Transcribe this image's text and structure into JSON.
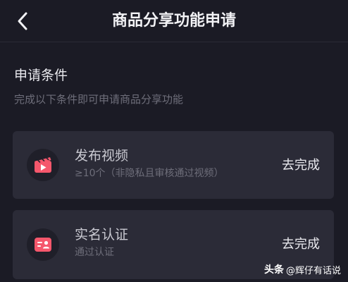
{
  "header": {
    "back_icon": "chevron-left-icon",
    "title": "商品分享功能申请"
  },
  "section": {
    "title": "申请条件",
    "subtitle": "完成以下条件即可申请商品分享功能"
  },
  "conditions": [
    {
      "icon": "video-clapper-icon",
      "title": "发布视频",
      "description": "≥10个（非隐私且审核通过视频）",
      "action": "去完成"
    },
    {
      "icon": "id-card-icon",
      "title": "实名认证",
      "description": "通过认证",
      "action": "去完成"
    }
  ],
  "watermark": {
    "brand": "头条",
    "handle": "@辉仔有话说"
  },
  "colors": {
    "background": "#1b1b25",
    "card": "#2b2b37",
    "accent": "#f5576c"
  }
}
